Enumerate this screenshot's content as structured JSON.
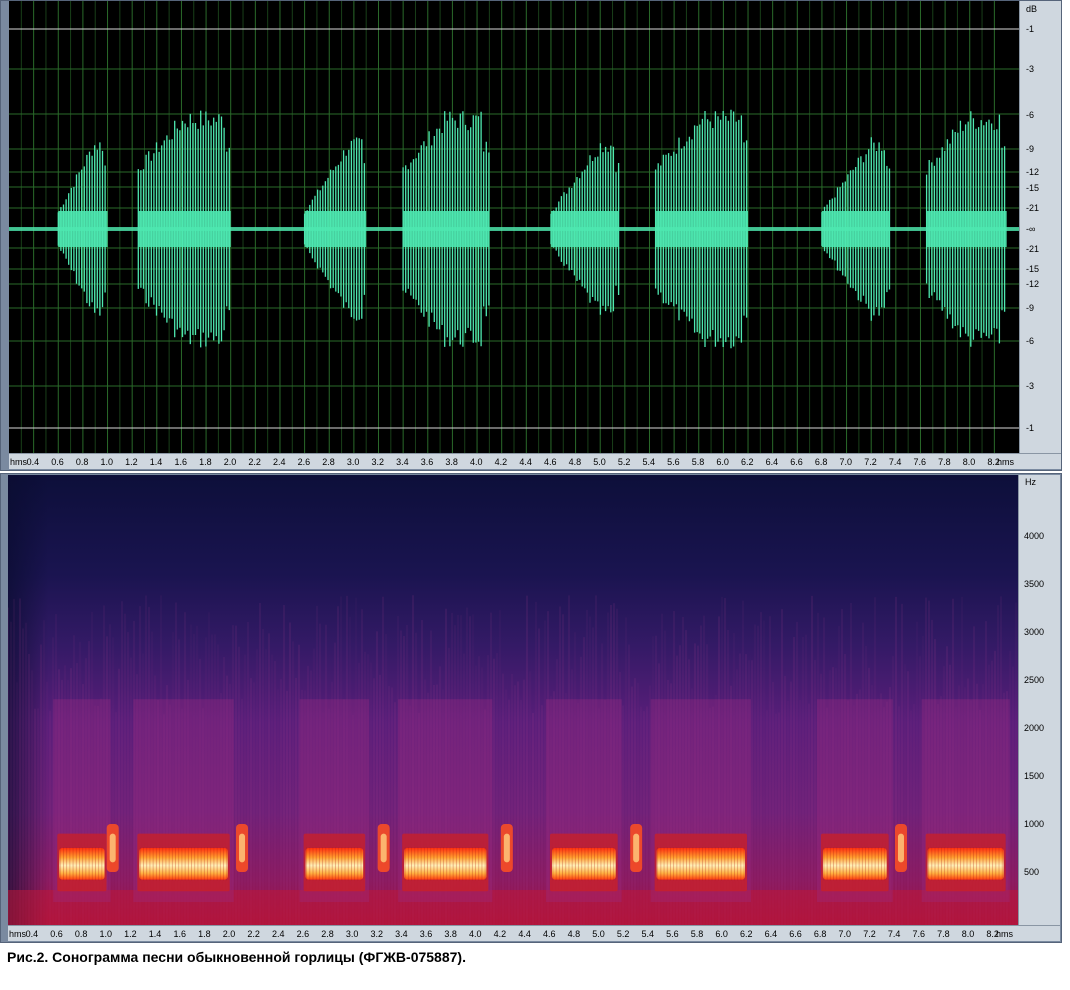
{
  "colors": {
    "wave": "#4ee8b0",
    "grid": "#2a6a2a",
    "ref_line": "#d8d8d8",
    "panel_bg": "#000000",
    "ruler_bg": "#cfd7df"
  },
  "waveform": {
    "db_unit": "dB",
    "db_labels_top": [
      "-1",
      "-3",
      "-6",
      "-9",
      "-12",
      "-15",
      "-21",
      "-∞"
    ],
    "db_labels_bottom": [
      "-21",
      "-15",
      "-12",
      "-9",
      "-6",
      "-3",
      "-1"
    ],
    "time_unit_left": "hms",
    "time_unit_right": "hms"
  },
  "spectrogram": {
    "freq_unit": "Hz",
    "freq_labels": [
      "4000",
      "3500",
      "3000",
      "2500",
      "2000",
      "1500",
      "1000",
      "500"
    ],
    "time_unit_left": "hms",
    "time_unit_right": "hms"
  },
  "time_ticks": [
    "0.4",
    "0.6",
    "0.8",
    "1.0",
    "1.2",
    "1.4",
    "1.6",
    "1.8",
    "2.0",
    "2.2",
    "2.4",
    "2.6",
    "2.8",
    "3.0",
    "3.2",
    "3.4",
    "3.6",
    "3.8",
    "4.0",
    "4.2",
    "4.4",
    "4.6",
    "4.8",
    "5.0",
    "5.2",
    "5.4",
    "5.6",
    "5.8",
    "6.0",
    "6.2",
    "6.4",
    "6.6",
    "6.8",
    "7.0",
    "7.2",
    "7.4",
    "7.6",
    "7.8",
    "8.0",
    "8.2"
  ],
  "song_phrases": [
    {
      "start": 0.6,
      "end": 1.0
    },
    {
      "start": 1.25,
      "end": 2.0
    },
    {
      "start": 2.6,
      "end": 3.1
    },
    {
      "start": 3.4,
      "end": 4.1
    },
    {
      "start": 4.6,
      "end": 5.15
    },
    {
      "start": 5.45,
      "end": 6.2
    },
    {
      "start": 6.8,
      "end": 7.35
    },
    {
      "start": 7.65,
      "end": 8.3
    }
  ],
  "caption": "Рис.2. Сонограмма песни обыкновенной горлицы (ФГЖВ-075887)."
}
